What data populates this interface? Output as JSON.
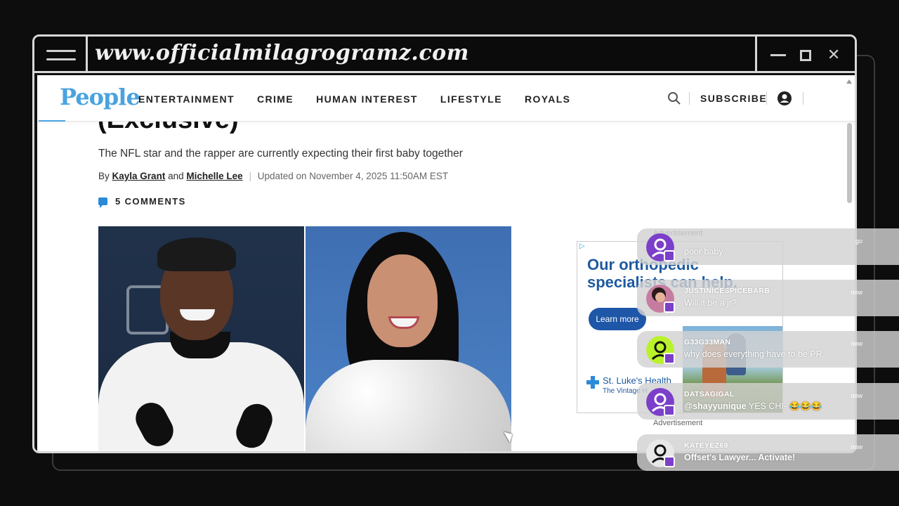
{
  "overlay": {
    "url": "www.officialmilagrogramz.com",
    "window_controls": {
      "minimize": "minimize",
      "maximize": "maximize",
      "close": "✕"
    }
  },
  "site": {
    "logo": "People",
    "nav": [
      "ENTERTAINMENT",
      "CRIME",
      "HUMAN INTEREST",
      "LIFESTYLE",
      "ROYALS"
    ],
    "subscribe": "SUBSCRIBE",
    "brand_color": "#4aa3df"
  },
  "article": {
    "headline_tail": "(Exclusive)",
    "dek": "The NFL star and the rapper are currently expecting their first baby together",
    "byline_prefix": "By",
    "author1": "Kayla Grant",
    "and": "and",
    "author2": "Michelle Lee",
    "updated": "Updated on November 4, 2025 11:50AM EST",
    "comments": "5 COMMENTS"
  },
  "ad": {
    "label": "Advertisement",
    "headline": "Our orthopedic specialists can help.",
    "cta": "Learn more",
    "brand": "St. Luke's Health",
    "brand_sub": "The Vintage H",
    "accent": "#1e56a8"
  },
  "chat": [
    {
      "user": "",
      "message": "poor baby",
      "time": "go",
      "avatar_color": "#7b3fc9"
    },
    {
      "user": "JUSTINICESPICEBARB",
      "message": "Will it be a jr?",
      "time": "now",
      "avatar_color": "#c67ca0"
    },
    {
      "user": "G33G33MAN",
      "message": "why does everything have to be PR",
      "time": "now",
      "avatar_color": "#b9f22a"
    },
    {
      "user": "DATSAGIGAL",
      "mention": "@shayyunique",
      "message": " YES CHI- 😂😂😂",
      "time": "now",
      "avatar_color": "#7b3fc9"
    },
    {
      "user": "KATEYEZ69",
      "message": "Offset's Lawyer... Activate!",
      "time": "now",
      "avatar_color": "#e8e8e8"
    }
  ]
}
